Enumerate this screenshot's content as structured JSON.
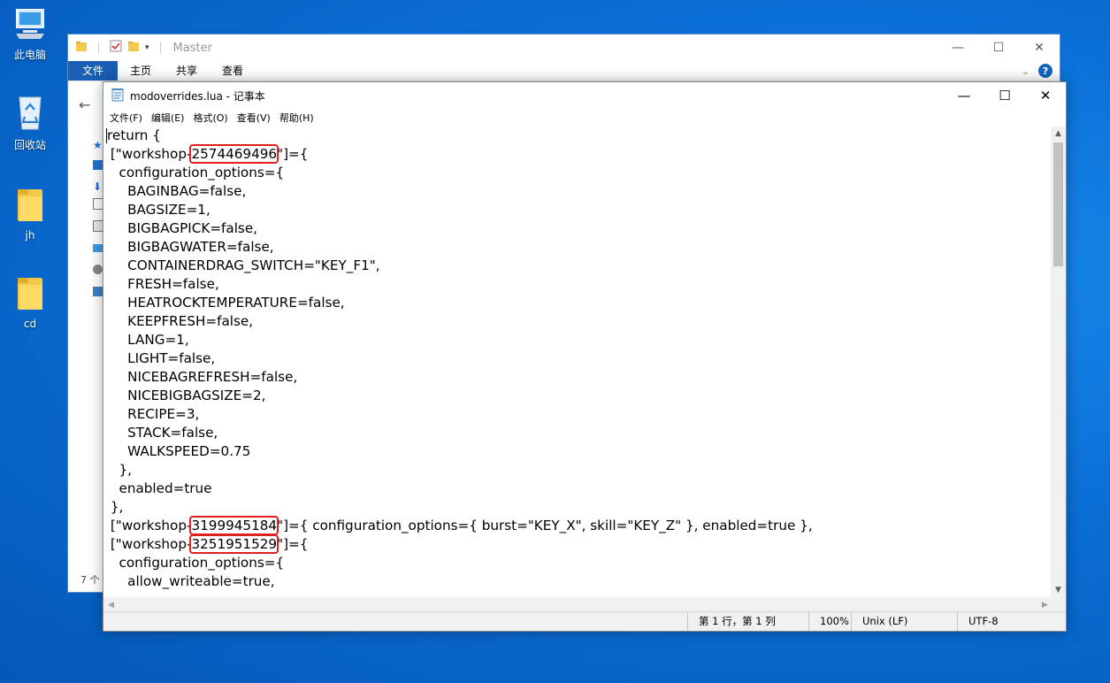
{
  "desktop": {
    "icons": [
      {
        "label": "此电脑",
        "icon": "computer-icon"
      },
      {
        "label": "回收站",
        "icon": "recycle-bin-icon"
      },
      {
        "label": "jh",
        "icon": "folder-icon"
      },
      {
        "label": "cd",
        "icon": "folder-icon"
      }
    ]
  },
  "explorer": {
    "title": "Master",
    "tabs": [
      "文件",
      "主页",
      "共享",
      "查看"
    ],
    "status_text": "7 个"
  },
  "notepad": {
    "title": "modoverrides.lua - 记事本",
    "menu": [
      "文件(F)",
      "编辑(E)",
      "格式(O)",
      "查看(V)",
      "帮助(H)"
    ],
    "code": {
      "l0": "return {",
      "l1a": " [\"workshop-",
      "l1id": "2574469496",
      "l1b": "\"]={",
      "l2": "   configuration_options={",
      "l3": "     BAGINBAG=false,",
      "l4": "     BAGSIZE=1,",
      "l5": "     BIGBAGPICK=false,",
      "l6": "     BIGBAGWATER=false,",
      "l7": "     CONTAINERDRAG_SWITCH=\"KEY_F1\",",
      "l8": "     FRESH=false,",
      "l9": "     HEATROCKTEMPERATURE=false,",
      "l10": "     KEEPFRESH=false,",
      "l11": "     LANG=1,",
      "l12": "     LIGHT=false,",
      "l13": "     NICEBAGREFRESH=false,",
      "l14": "     NICEBIGBAGSIZE=2,",
      "l15": "     RECIPE=3,",
      "l16": "     STACK=false,",
      "l17": "     WALKSPEED=0.75",
      "l18": "   },",
      "l19": "   enabled=true",
      "l20": " },",
      "l21a": " [\"workshop-",
      "l21id": "3199945184",
      "l21b": "\"]={ configuration_options={ burst=\"KEY_X\", skill=\"KEY_Z\" }, enabled=true },",
      "l22a": " [\"workshop-",
      "l22id": "3251951529",
      "l22b": "\"]={",
      "l23": "   configuration_options={",
      "l24": "     allow_writeable=true,"
    },
    "status": {
      "position": "第 1 行，第 1 列",
      "zoom": "100%",
      "line_ending": "Unix (LF)",
      "encoding": "UTF-8"
    }
  }
}
